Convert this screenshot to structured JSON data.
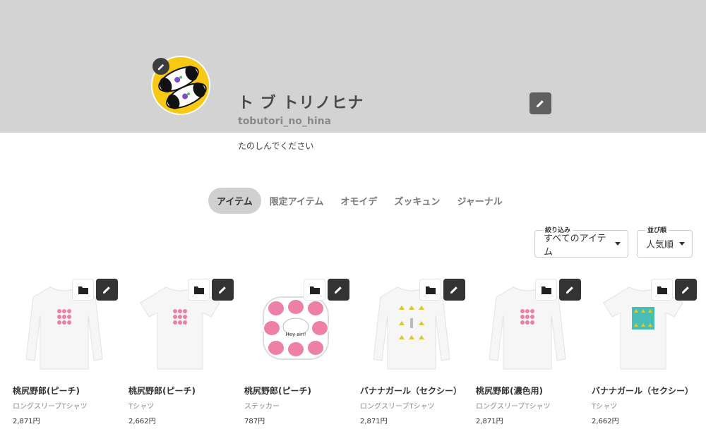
{
  "profile": {
    "name": "ト ブ トリノヒナ",
    "id": "tobutori_no_hina",
    "description": "たのしんでください",
    "avatar_icon": "panda-avatar",
    "avatar_edit_icon": "pencil-icon",
    "cover_edit_icon": "pencil-icon"
  },
  "tabs": [
    {
      "label": "アイテム",
      "active": true
    },
    {
      "label": "限定アイテム",
      "active": false
    },
    {
      "label": "オモイデ",
      "active": false
    },
    {
      "label": "ズッキュン",
      "active": false
    },
    {
      "label": "ジャーナル",
      "active": false
    }
  ],
  "filters": {
    "filter": {
      "label": "絞り込み",
      "value": "すべてのアイテム"
    },
    "sort": {
      "label": "並び順",
      "value": "人気順"
    }
  },
  "products": [
    {
      "title": "桃尻野郎(ピーチ)",
      "type": "ロングスリーブTシャツ",
      "price": "2,871円",
      "garment": "longsleeve",
      "design": "peach"
    },
    {
      "title": "桃尻野郎(ピーチ)",
      "type": "Tシャツ",
      "price": "2,662円",
      "garment": "tshirt",
      "design": "peach"
    },
    {
      "title": "桃尻野郎(ピーチ)",
      "type": "ステッカー",
      "price": "787円",
      "garment": "sticker",
      "design": "peach"
    },
    {
      "title": "バナナガール（セクシー）",
      "type": "ロングスリーブTシャツ",
      "price": "2,871円",
      "garment": "longsleeve",
      "design": "banana"
    },
    {
      "title": "桃尻野郎(濃色用)",
      "type": "ロングスリーブTシャツ",
      "price": "2,871円",
      "garment": "longsleeve",
      "design": "peach"
    },
    {
      "title": "バナナガール（セクシー）",
      "type": "Tシャツ",
      "price": "2,662円",
      "garment": "tshirt",
      "design": "banana-teal"
    }
  ],
  "colors": {
    "cover": "#d3d3d3",
    "avatar_bg": "#f8c914",
    "peach": "#ee7fa6",
    "banana": "#d9c92a",
    "teal": "#49bdb8"
  }
}
